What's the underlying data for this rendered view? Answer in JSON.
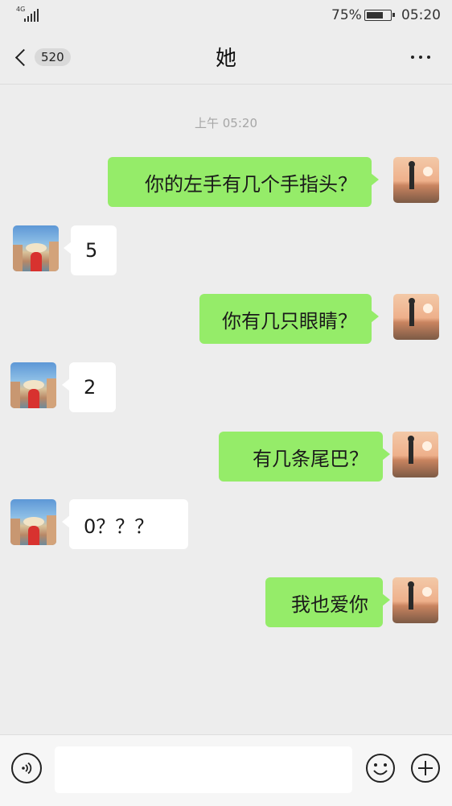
{
  "status_bar": {
    "network": "4G",
    "battery_percent": "75%",
    "battery_level": 0.75,
    "time": "05:20"
  },
  "nav": {
    "unread_count": "520",
    "title": "她",
    "icons": {
      "back": "chevron-left-icon",
      "more": "more-dots-icon"
    }
  },
  "chat": {
    "timestamp": "上午 05:20",
    "messages": [
      {
        "sender": "me",
        "text": "你的左手有几个手指头？"
      },
      {
        "sender": "her",
        "text": "5"
      },
      {
        "sender": "me",
        "text": "你有几只眼睛？"
      },
      {
        "sender": "her",
        "text": "2"
      },
      {
        "sender": "me",
        "text": "有几条尾巴？"
      },
      {
        "sender": "her",
        "text": "0？？？"
      },
      {
        "sender": "me",
        "text": "我也爱你"
      }
    ]
  },
  "input_bar": {
    "value": "",
    "icons": {
      "voice": "voice-icon",
      "emoji": "emoji-icon",
      "more": "plus-icon"
    }
  },
  "colors": {
    "background": "#ededed",
    "my_bubble": "#95ec69",
    "her_bubble": "#ffffff",
    "timestamp_text": "#a6a6a6"
  }
}
